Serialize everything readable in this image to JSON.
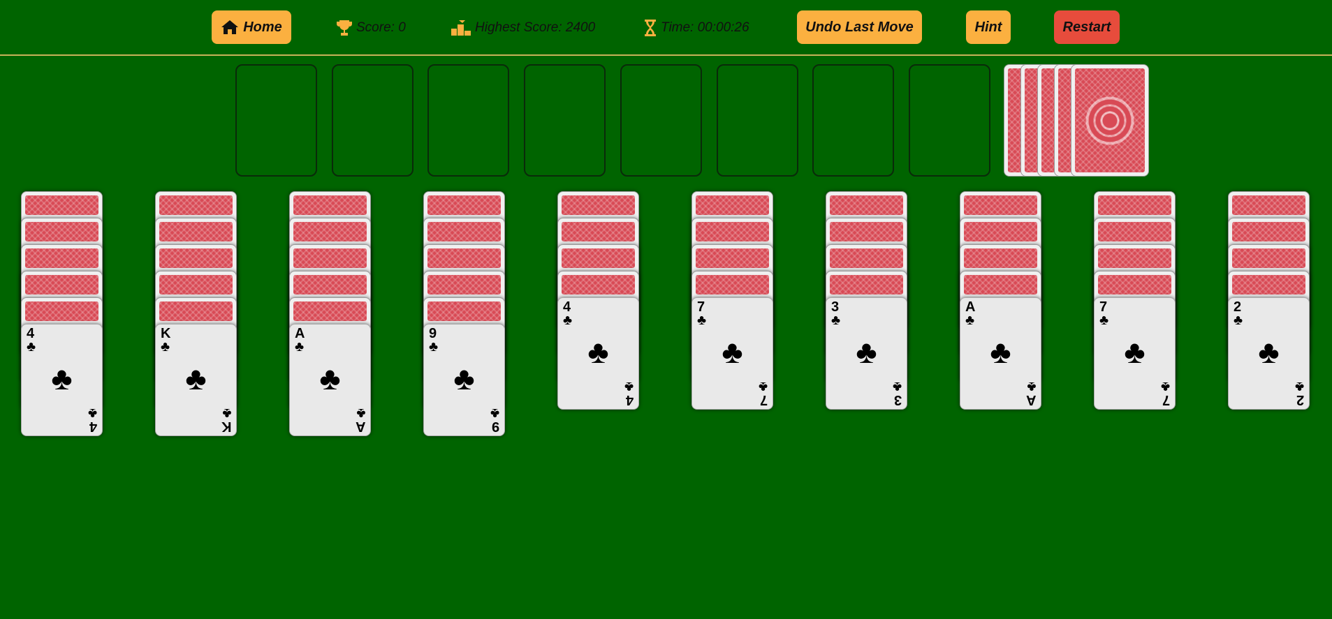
{
  "toolbar": {
    "home_label": "Home",
    "score_label": "Score: 0",
    "highest_score_label": "Highest Score: 2400",
    "time_label": "Time: 00:00:26",
    "undo_label": "Undo Last Move",
    "hint_label": "Hint",
    "restart_label": "Restart"
  },
  "colors": {
    "table": "#006400",
    "button": "#fbb040",
    "restart": "#e74c3c",
    "card_back": "#d84a55"
  },
  "icons": {
    "home": "house-icon",
    "score": "trophy-icon",
    "highest": "podium-icon",
    "time": "hourglass-icon"
  },
  "foundations_empty": 8,
  "stock_piles": 5,
  "tableau": [
    {
      "hidden": 5,
      "rank": "4",
      "suit": "♣"
    },
    {
      "hidden": 5,
      "rank": "K",
      "suit": "♣"
    },
    {
      "hidden": 5,
      "rank": "A",
      "suit": "♣"
    },
    {
      "hidden": 5,
      "rank": "9",
      "suit": "♣"
    },
    {
      "hidden": 4,
      "rank": "4",
      "suit": "♣"
    },
    {
      "hidden": 4,
      "rank": "7",
      "suit": "♣"
    },
    {
      "hidden": 4,
      "rank": "3",
      "suit": "♣"
    },
    {
      "hidden": 4,
      "rank": "A",
      "suit": "♣"
    },
    {
      "hidden": 4,
      "rank": "7",
      "suit": "♣"
    },
    {
      "hidden": 4,
      "rank": "2",
      "suit": "♣"
    }
  ]
}
